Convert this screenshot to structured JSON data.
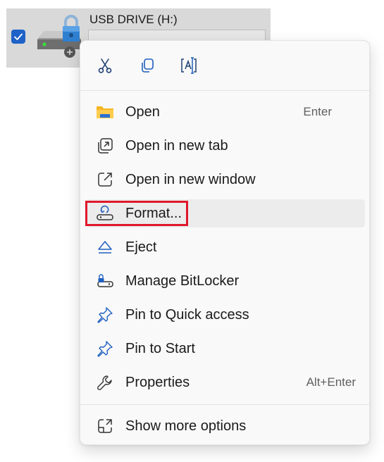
{
  "drive": {
    "name": "USB DRIVE (H:)",
    "selected": true
  },
  "quick_actions": [
    {
      "icon": "scissors-icon",
      "action": "cut"
    },
    {
      "icon": "copy-icon",
      "action": "copy"
    },
    {
      "icon": "rename-icon",
      "action": "rename"
    }
  ],
  "menu": {
    "items": [
      {
        "label": "Open",
        "shortcut": "Enter",
        "icon": "folder-icon"
      },
      {
        "label": "Open in new tab",
        "shortcut": "",
        "icon": "new-tab-icon"
      },
      {
        "label": "Open in new window",
        "shortcut": "",
        "icon": "new-window-icon"
      },
      {
        "label": "Format...",
        "shortcut": "",
        "icon": "format-icon"
      },
      {
        "label": "Eject",
        "shortcut": "",
        "icon": "eject-icon"
      },
      {
        "label": "Manage BitLocker",
        "shortcut": "",
        "icon": "bitlocker-icon"
      },
      {
        "label": "Pin to Quick access",
        "shortcut": "",
        "icon": "pin-icon"
      },
      {
        "label": "Pin to Start",
        "shortcut": "",
        "icon": "pin-icon"
      },
      {
        "label": "Properties",
        "shortcut": "Alt+Enter",
        "icon": "wrench-icon"
      }
    ],
    "more": {
      "label": "Show more options",
      "icon": "show-more-icon"
    }
  },
  "colors": {
    "accent": "#1e62c8",
    "highlight": "#e0182d",
    "folder": "#f4b724"
  }
}
